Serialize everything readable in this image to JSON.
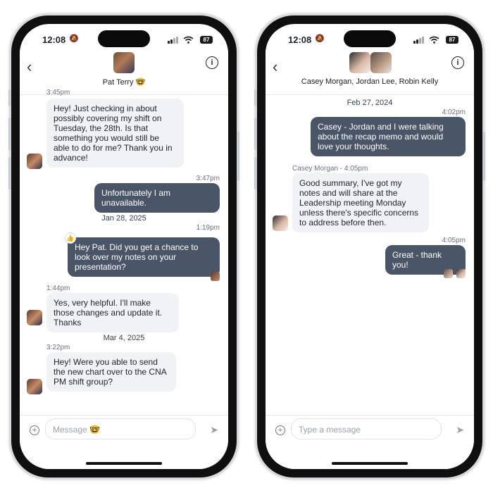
{
  "left": {
    "status": {
      "time": "12:08",
      "battery": "87"
    },
    "header": {
      "name": "Pat Terry 🤓"
    },
    "messages": [
      {
        "time_partial": "3:45pm",
        "text": "Hey! Just checking in about possibly covering my shift on Tuesday, the 28th. Is that something you would still be able to do for me? Thank you in advance!"
      },
      {
        "time": "3:47pm",
        "text": "Unfortunately I am unavailable."
      },
      {
        "date": "Jan 28, 2025"
      },
      {
        "time": "1:19pm",
        "text": "Hey Pat. Did you get a chance to look over my notes on your presentation?",
        "reaction": "👍"
      },
      {
        "time": "1:44pm",
        "text": "Yes, very helpful. I'll make those changes and update it. Thanks"
      },
      {
        "date": "Mar 4, 2025"
      },
      {
        "time": "3:22pm",
        "text": "Hey! Were you able to send the new chart over to the CNA PM shift group?"
      }
    ],
    "composer": {
      "placeholder": "Message 🤓"
    }
  },
  "right": {
    "status": {
      "time": "12:08",
      "battery": "87"
    },
    "header": {
      "names": "Casey Morgan, Jordan Lee, Robin Kelly"
    },
    "messages": [
      {
        "date": "Feb 27, 2024"
      },
      {
        "time": "4:02pm",
        "text": "Casey - Jordan and I were talking about the recap memo and would love your thoughts."
      },
      {
        "meta": "Casey Morgan - 4:05pm",
        "text": "Good summary, I've got my notes and will share at the Leadership meeting Monday unless there's specific concerns to address before then."
      },
      {
        "time": "4:05pm",
        "text": "Great - thank you!"
      }
    ],
    "composer": {
      "placeholder": "Type a message"
    }
  },
  "icons": {
    "back": "chevron-left-icon",
    "info": "info-icon",
    "plus": "plus-circle-icon",
    "send": "send-icon"
  }
}
